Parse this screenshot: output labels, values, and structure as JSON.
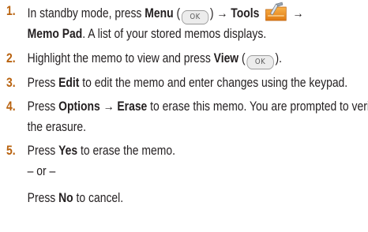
{
  "steps": [
    {
      "number": "1.",
      "parts": [
        "In standby mode, press ",
        "Menu",
        " (",
        "OK",
        ") → ",
        "Tools",
        "→",
        "Memo Pad",
        ". A list of your stored memos displays."
      ]
    },
    {
      "number": "2.",
      "parts": [
        "Highlight the memo to view and press ",
        "View",
        " (",
        "OK",
        ")."
      ]
    },
    {
      "number": "3.",
      "parts": [
        "Press ",
        "Edit",
        " to edit the memo and enter changes using the keypad."
      ]
    },
    {
      "number": "4.",
      "parts": [
        "Press ",
        "Options → Erase",
        " to erase this memo. You are prompted to verify the erasure."
      ]
    },
    {
      "number": "5.",
      "parts": [
        "Press ",
        "Yes",
        " to erase the memo."
      ],
      "or_text": "– or –",
      "alt": [
        "Press ",
        "No",
        " to cancel."
      ]
    }
  ],
  "icons": {
    "ok_key": "ok-key-icon",
    "tools": "tools-icon"
  },
  "colors": {
    "step_number": "#b8620f",
    "text": "#231f20"
  }
}
